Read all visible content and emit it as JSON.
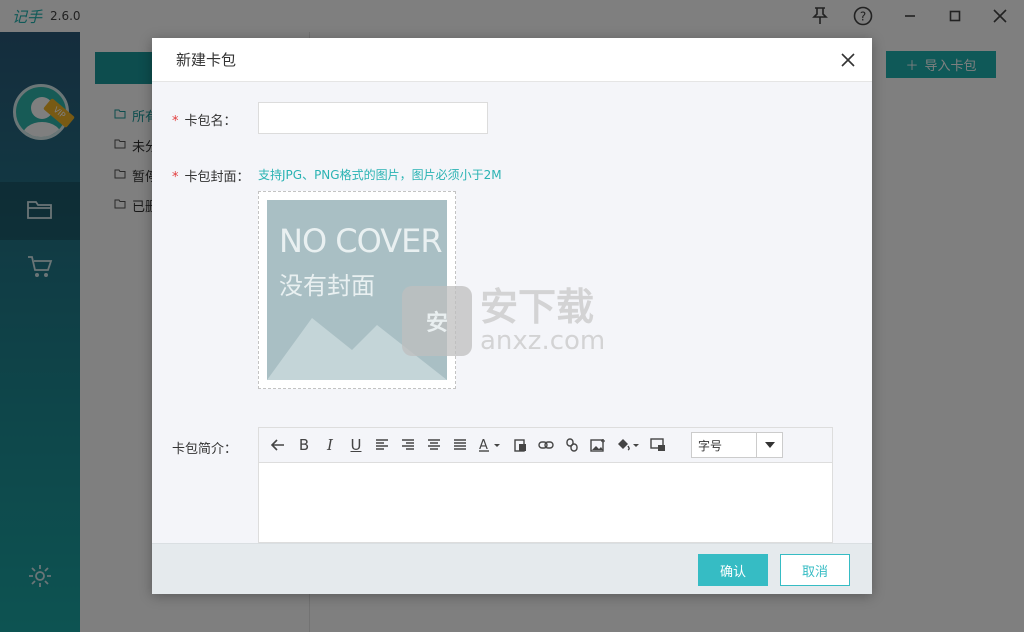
{
  "app": {
    "name": "记手",
    "version": "2.6.0"
  },
  "titlebar": {
    "pin_icon": "pin-icon",
    "help_icon": "help-icon",
    "minimize_icon": "minimize-icon",
    "maximize_icon": "maximize-icon",
    "close_icon": "close-icon"
  },
  "sidebar": {
    "vip_badge": "VIP",
    "nav": [
      {
        "icon": "folder-icon"
      },
      {
        "icon": "cart-icon"
      },
      {
        "icon": "gear-icon"
      }
    ]
  },
  "tree": {
    "items": [
      {
        "label": "所有"
      },
      {
        "label": "未分"
      },
      {
        "label": "暂停"
      },
      {
        "label": "已删"
      }
    ]
  },
  "toolbar_main": {
    "import_label": "导入卡包"
  },
  "modal": {
    "title": "新建卡包",
    "name_label": "卡包名：",
    "name_value": "",
    "cover_label": "卡包封面：",
    "cover_hint": "支持JPG、PNG格式的图片，图片必须小于2M",
    "cover_text_en": "NO COVER",
    "cover_text_cn": "没有封面",
    "intro_label": "卡包简介：",
    "font_size_placeholder": "字号",
    "ok_label": "确认",
    "cancel_label": "取消"
  },
  "watermark": {
    "cn": "安下载",
    "en": "anxz.com",
    "shield": "安"
  },
  "colors": {
    "accent": "#36bcc4",
    "teal_dark": "#1a9b9d",
    "required": "#e23b3b"
  }
}
